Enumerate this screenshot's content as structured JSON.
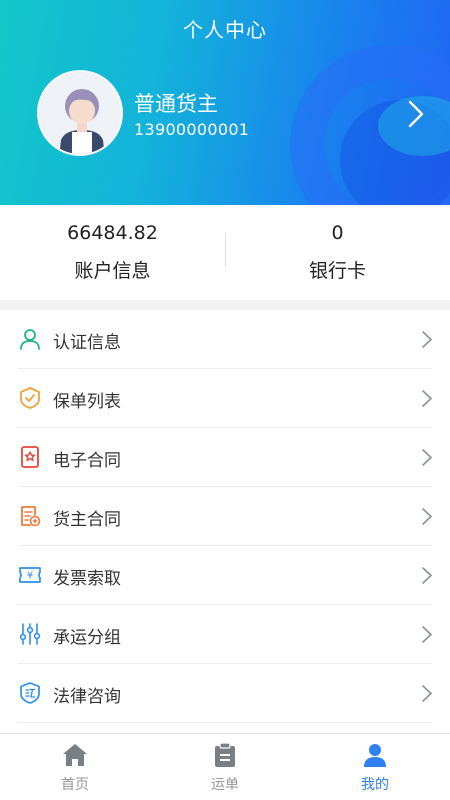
{
  "header": {
    "title": "个人中心",
    "user_name": "普通货主",
    "user_phone": "13900000001"
  },
  "stats": [
    {
      "value": "66484.82",
      "label": "账户信息"
    },
    {
      "value": "0",
      "label": "银行卡"
    }
  ],
  "menu": [
    {
      "label": "认证信息",
      "icon": "user-icon",
      "color": "#22b389"
    },
    {
      "label": "保单列表",
      "icon": "shield-check-icon",
      "color": "#f0a23a"
    },
    {
      "label": "电子合同",
      "icon": "star-card-icon",
      "color": "#e8453c"
    },
    {
      "label": "货主合同",
      "icon": "contract-seal-icon",
      "color": "#f07a3a"
    },
    {
      "label": "发票索取",
      "icon": "invoice-ticket-icon",
      "color": "#2f8fe8"
    },
    {
      "label": "承运分组",
      "icon": "sliders-icon",
      "color": "#2f8fe8"
    },
    {
      "label": "法律咨询",
      "icon": "law-shield-icon",
      "color": "#2f8fe8"
    }
  ],
  "tabs": [
    {
      "label": "首页",
      "icon": "home-icon"
    },
    {
      "label": "运单",
      "icon": "clipboard-icon"
    },
    {
      "label": "我的",
      "icon": "person-icon",
      "active": true
    }
  ],
  "colors": {
    "accent": "#2f80f0",
    "header_start": "#12c7c9",
    "header_end": "#2164f2",
    "tab_inactive": "#999999"
  }
}
